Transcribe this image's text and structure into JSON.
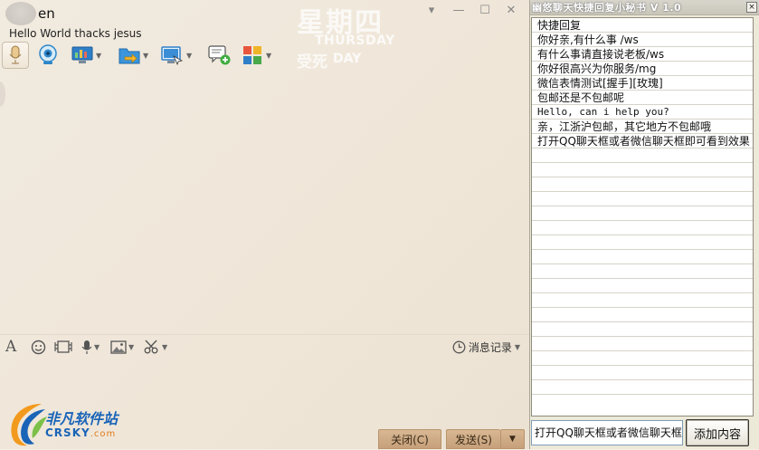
{
  "chat": {
    "nickname": "en",
    "signature": "Hello World thacks jesus",
    "weekday_cn": "星期四",
    "weekday_en": "THURSDAY",
    "weekday_sub_cn": "受死",
    "weekday_sub_en": "DAY",
    "window_buttons": {
      "dropdown": "▾",
      "minimize": "—",
      "maximize": "☐",
      "close": "✕"
    },
    "input_toolbar": {
      "font": "A",
      "history_label": "消息记录"
    },
    "close_button": "关闭(C)",
    "send_button": "发送(S)",
    "send_arrow": "▼"
  },
  "logo": {
    "name": "非凡软件站",
    "sub": "CRSKY",
    "domain": ".com"
  },
  "panel": {
    "title": "幽悠聊天快捷回复小秘书 V 1.0",
    "close": "×",
    "header": "快捷回复",
    "replies": [
      "你好亲,有什么事 /ws",
      "有什么事请直接说老板/ws",
      "你好很高兴为你服务/mg",
      "微信表情测试[握手][玫瑰]",
      "包邮还是不包邮呢",
      "Hello, can i help you?",
      "亲，江浙沪包邮，其它地方不包邮哦",
      "打开QQ聊天框或者微信聊天框即可看到效果"
    ],
    "input_value": "打开QQ聊天框或者微信聊天框即",
    "add_button": "添加内容"
  },
  "colors": {
    "chat_bg": "#efe6d8",
    "button_tan": "#c6a07a",
    "panel_bg": "#ece9d8",
    "logo_blue": "#1a64b8"
  }
}
